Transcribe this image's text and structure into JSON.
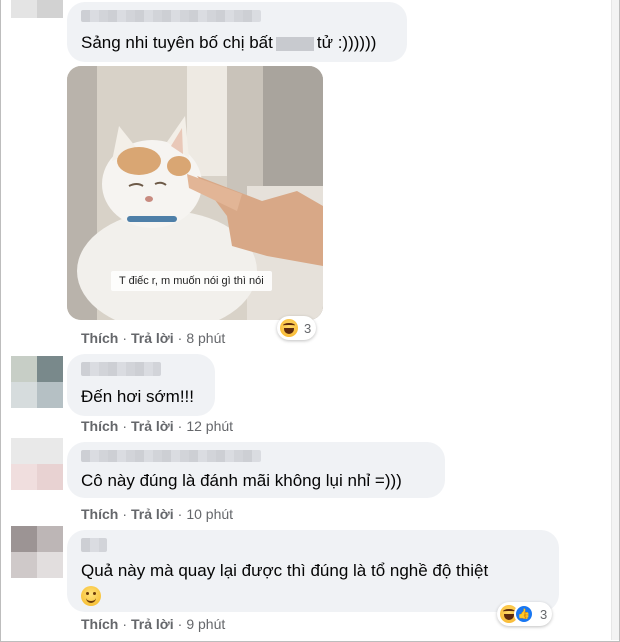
{
  "comments": [
    {
      "text_before": "Sảng nhi tuyên bố chị bất",
      "text_after": "tử :))))))",
      "image_caption": "T điếc r, m muốn nói gì thì nói",
      "like_label": "Thích",
      "reply_label": "Trả lời",
      "time": "8 phút",
      "reaction_count": "3",
      "reaction_icons": [
        "haha-icon"
      ]
    },
    {
      "text": "Đến hơi sớm!!!",
      "like_label": "Thích",
      "reply_label": "Trả lời",
      "time": "12 phút"
    },
    {
      "text": "Cô này đúng là đánh mãi không lụi nhỉ =)))",
      "like_label": "Thích",
      "reply_label": "Trả lời",
      "time": "10 phút"
    },
    {
      "text": "Quả này mà quay lại được thì đúng là tổ nghề độ thiệt",
      "emoji": "slightly-smiling-face",
      "like_label": "Thích",
      "reply_label": "Trả lời",
      "time": "9 phút",
      "reaction_count": "3",
      "reaction_icons": [
        "haha-icon",
        "like-icon"
      ]
    }
  ],
  "colors": {
    "bubble": "#f0f2f5",
    "meta_text": "#65676b",
    "like_blue": "#1877f2"
  }
}
